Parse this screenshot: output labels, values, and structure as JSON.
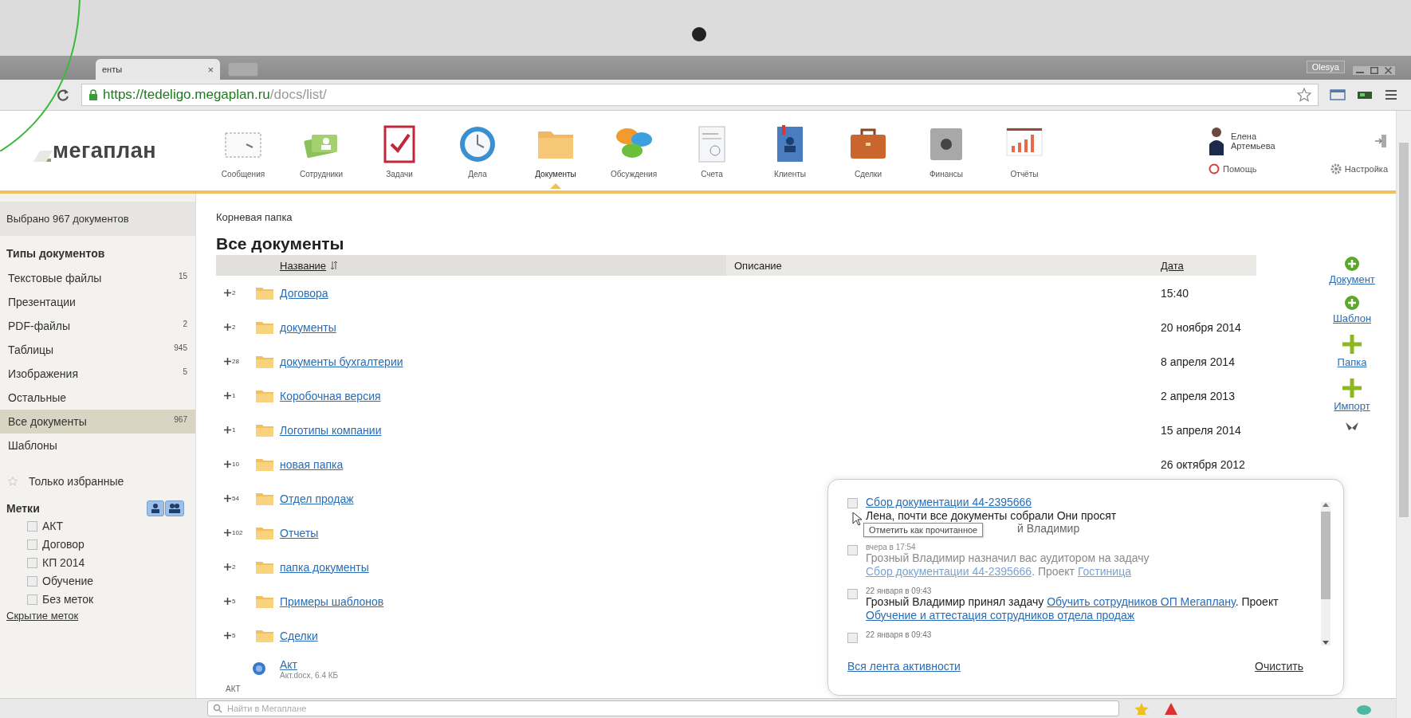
{
  "browser": {
    "tab_title": "енты",
    "tab_close": "×",
    "profile": "Olesya",
    "url_host": "https://tedeligo.megaplan.ru",
    "url_path": "/docs/list/"
  },
  "app": {
    "logo": "мегаплан",
    "nav": [
      {
        "label": "Сообщения",
        "kind": "envelope",
        "selected": false
      },
      {
        "label": "Сотрудники",
        "kind": "people",
        "selected": false
      },
      {
        "label": "Задачи",
        "kind": "task",
        "selected": false
      },
      {
        "label": "Дела",
        "kind": "clock",
        "selected": false
      },
      {
        "label": "Документы",
        "kind": "folder",
        "selected": true
      },
      {
        "label": "Обсуждения",
        "kind": "chat",
        "selected": false
      },
      {
        "label": "Счета",
        "kind": "invoice",
        "selected": false
      },
      {
        "label": "Клиенты",
        "kind": "contacts",
        "selected": false
      },
      {
        "label": "Сделки",
        "kind": "briefcase",
        "selected": false
      },
      {
        "label": "Финансы",
        "kind": "safe",
        "selected": false
      },
      {
        "label": "Отчёты",
        "kind": "chart",
        "selected": false
      }
    ],
    "user": {
      "name": "Елена Артемьева",
      "help": "Помощь",
      "settings": "Настройка"
    }
  },
  "sidebar": {
    "selection": "Выбрано 967 документов",
    "types_title": "Типы документов",
    "types": [
      {
        "label": "Текстовые файлы",
        "count": "15",
        "selected": false
      },
      {
        "label": "Презентации",
        "selected": false
      },
      {
        "label": "PDF-файлы",
        "count": "2",
        "selected": false
      },
      {
        "label": "Таблицы",
        "count": "945",
        "selected": false
      },
      {
        "label": "Изображения",
        "count": "5",
        "selected": false
      },
      {
        "label": "Остальные",
        "selected": false
      },
      {
        "label": "Все документы",
        "count": "967",
        "selected": true
      },
      {
        "label": "Шаблоны",
        "selected": false
      }
    ],
    "favorites": "Только избранные",
    "tags_title": "Метки",
    "tag_views": [
      {
        "kind": "person",
        "selected": false
      },
      {
        "kind": "people",
        "selected": false
      }
    ],
    "tags": [
      {
        "label": "АКТ",
        "checked": false
      },
      {
        "label": "Договор",
        "checked": false
      },
      {
        "label": "КП 2014",
        "checked": false
      },
      {
        "label": "Обучение",
        "checked": false
      },
      {
        "label": "Без меток",
        "checked": false
      }
    ],
    "hide_tags": "Скрытие меток"
  },
  "main": {
    "breadcrumb": "Корневая папка",
    "title": "Все документы",
    "columns": [
      "Название",
      "Описание",
      "Дата"
    ],
    "rows": [
      {
        "kind": "folder",
        "count": "2",
        "name": "Договора",
        "date": "15:40"
      },
      {
        "kind": "folder",
        "count": "2",
        "name": "документы",
        "date": "20 ноября 2014"
      },
      {
        "kind": "folder",
        "count": "28",
        "name": "документы бухгалтерии",
        "date": "8 апреля 2014"
      },
      {
        "kind": "folder",
        "count": "1",
        "name": "Коробочная версия",
        "date": "2 апреля 2013"
      },
      {
        "kind": "folder",
        "count": "1",
        "name": "Логотипы компании",
        "date": "15 апреля 2014"
      },
      {
        "kind": "folder",
        "count": "10",
        "name": "новая папка",
        "date": "26 октября 2012"
      },
      {
        "kind": "folder",
        "count": "54",
        "name": "Отдел продаж"
      },
      {
        "kind": "folder",
        "count": "102",
        "name": "Отчеты"
      },
      {
        "kind": "folder",
        "count": "2",
        "name": "папка документы"
      },
      {
        "kind": "folder",
        "count": "5",
        "name": "Примеры шаблонов"
      },
      {
        "kind": "folder",
        "count": "5",
        "name": "Сделки"
      },
      {
        "kind": "file",
        "name": "Акт",
        "meta": "Акт.docx, 6.4 КБ",
        "tag": "АКТ"
      }
    ]
  },
  "actions": [
    {
      "kind": "circle",
      "label": "Документ"
    },
    {
      "kind": "circle",
      "label": "Шаблон"
    },
    {
      "kind": "plus",
      "label": "Папка"
    },
    {
      "kind": "plus",
      "label": "Импорт"
    }
  ],
  "notifications": {
    "items": [
      {
        "read": false,
        "checked": false,
        "parts": [
          {
            "kind": "link",
            "text": "Сбор документации 44-2395666"
          }
        ],
        "lines": [
          "Лена, почти все документы собрали Они просят",
          "й Владимир"
        ]
      },
      {
        "read": true,
        "checked": false,
        "time": "вчера в 17:54",
        "parts": [
          {
            "kind": "text",
            "text": "Грозный Владимир назначил вас аудитором на задачу "
          },
          {
            "kind": "link",
            "text": "Сбор документации 44-2395666"
          },
          {
            "kind": "text",
            "text": ". Проект "
          },
          {
            "kind": "link",
            "text": "Гостиница"
          }
        ]
      },
      {
        "read": false,
        "checked": false,
        "time": "22 января в 09:43",
        "parts": [
          {
            "kind": "text",
            "text": "Грозный Владимир принял задачу "
          },
          {
            "kind": "link",
            "text": "Обучить сотрудников ОП Мегаплану"
          },
          {
            "kind": "text",
            "text": ". Проект "
          },
          {
            "kind": "link",
            "text": "Обучение и аттестация сотрудников отдела продаж"
          }
        ]
      },
      {
        "read": false,
        "checked": false,
        "time": "22 января в 09:43"
      }
    ],
    "tooltip": "Отметить как прочитанное",
    "all_link": "Вся лента активности",
    "clear": "Очистить"
  },
  "search": {
    "placeholder": "Найти в Мегаплане"
  }
}
